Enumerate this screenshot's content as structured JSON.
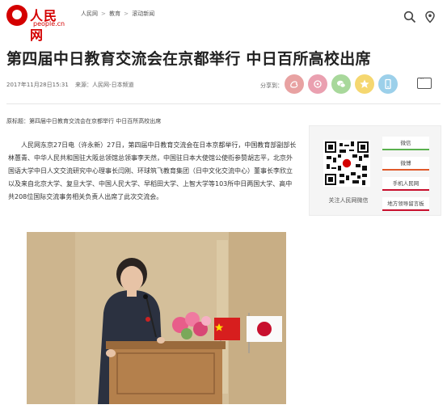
{
  "header": {
    "logo": {
      "name": "人民网",
      "sub": "people.cn"
    },
    "breadcrumb": [
      "人民网",
      "教育",
      "滚动新闻"
    ]
  },
  "article": {
    "title": "第四届中日教育交流会在京都举行 中日百所高校出席",
    "date": "2017年11月28日15:31",
    "source": "来源：人民网-日本频道",
    "share_label": "分享到：",
    "original_title": "原标题：第四届中日教育交流会在京都举行 中日百所高校出席",
    "body": "人民网东京27日电（许永新）27日，第四届中日教育交流会在日本京都举行，中国教育部副部长林蕙青、中华人民共和国驻大阪总领馆总领事李天然，中国驻日本大使馆公使衔参赞胡志平，北京外国语大学中日人文交流研究中心理事长闫刚、环球筑飞教育集团（日中文化交流中心）董事长李欣立以及来自北京大学、复旦大学、中国人民大学、早稻田大学、上智大学等103所中日两国大学、高中共208位国际交流事务相关负责人出席了此次交流会。"
  },
  "share_icons": [
    {
      "icon": "weibo-icon",
      "color": "#e8a2a2"
    },
    {
      "icon": "tencent-weibo-icon",
      "color": "#eaa0b0"
    },
    {
      "icon": "wechat-icon",
      "color": "#a8d89b"
    },
    {
      "icon": "qzone-icon",
      "color": "#f5d770"
    },
    {
      "icon": "mobile-icon",
      "color": "#9cd0ea"
    }
  ],
  "sidebar": {
    "qr_label": "关注人民网微信",
    "buttons": [
      {
        "label": "微信",
        "color": "#5ab14e"
      },
      {
        "label": "微博",
        "color": "#e05a2b"
      },
      {
        "label": "手机人民网",
        "color": "#c8102e"
      },
      {
        "label": "地方领导留言板",
        "color": "#c8102e"
      }
    ]
  },
  "colors": {
    "brand": "#d40000"
  }
}
